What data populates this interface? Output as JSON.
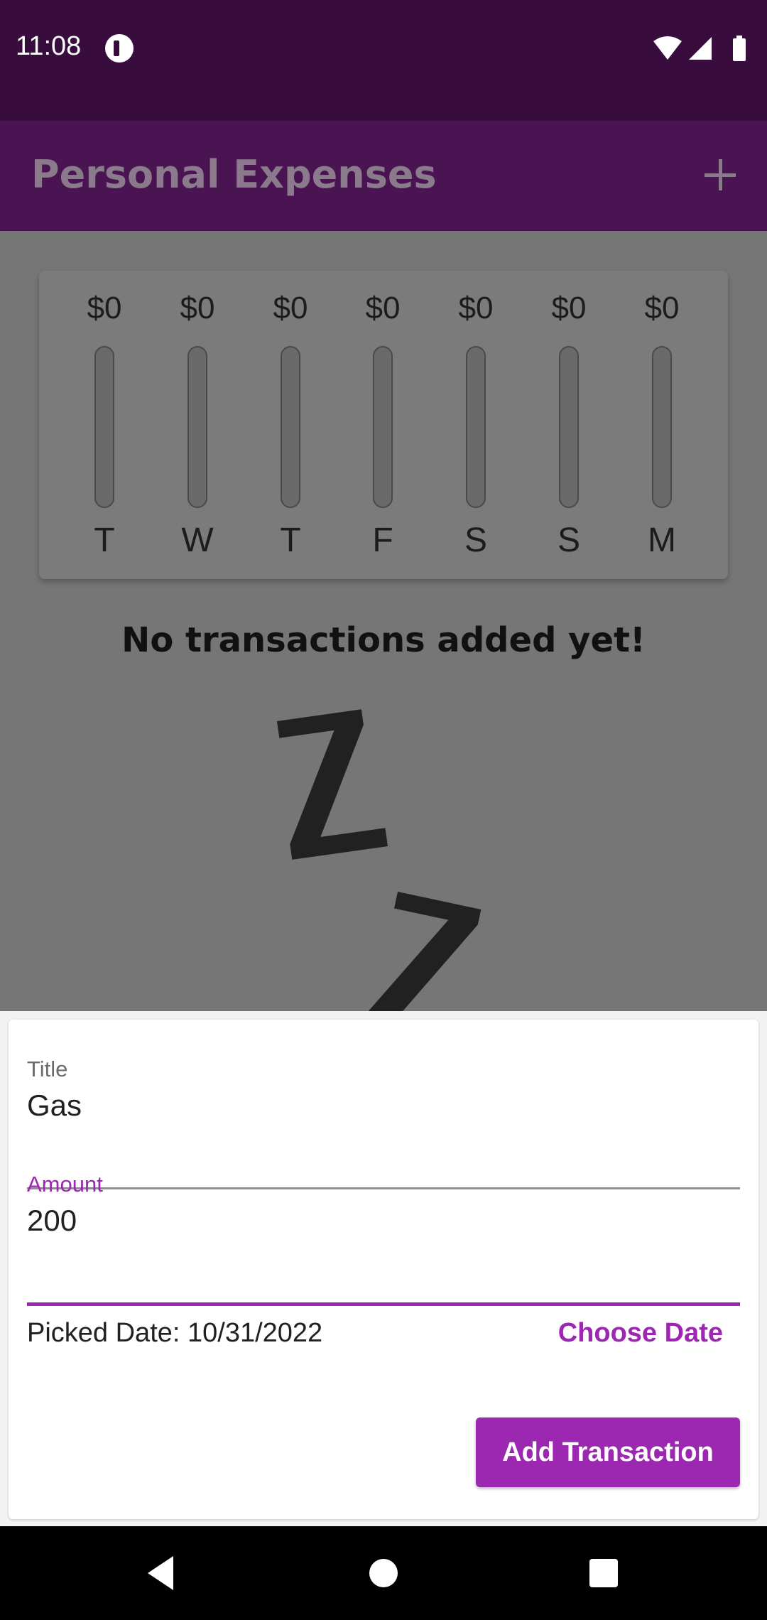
{
  "status_bar": {
    "time": "11:08",
    "icons": [
      "wifi-icon",
      "signal-icon",
      "battery-icon"
    ]
  },
  "app_bar": {
    "title": "Personal Expenses",
    "add_icon": "plus-icon"
  },
  "chart": {
    "days": [
      {
        "day": "T",
        "amount": "$0",
        "fill": 0
      },
      {
        "day": "W",
        "amount": "$0",
        "fill": 0
      },
      {
        "day": "T",
        "amount": "$0",
        "fill": 0
      },
      {
        "day": "F",
        "amount": "$0",
        "fill": 0
      },
      {
        "day": "S",
        "amount": "$0",
        "fill": 0
      },
      {
        "day": "S",
        "amount": "$0",
        "fill": 0
      },
      {
        "day": "M",
        "amount": "$0",
        "fill": 0
      }
    ]
  },
  "empty_state": {
    "message": "No transactions added yet!",
    "image": "sleeping-z-illustration"
  },
  "form": {
    "title_label": "Title",
    "title_value": "Gas",
    "amount_label": "Amount",
    "amount_value": "200",
    "picked_date": "Picked Date: 10/31/2022",
    "choose_date_label": "Choose Date",
    "submit_label": "Add Transaction"
  },
  "colors": {
    "status_bar": "#380d3e",
    "app_bar": "#4a1452",
    "accent": "#9c27b0"
  },
  "nav_bar": {
    "buttons": [
      "back-icon",
      "home-icon",
      "recents-icon"
    ]
  }
}
